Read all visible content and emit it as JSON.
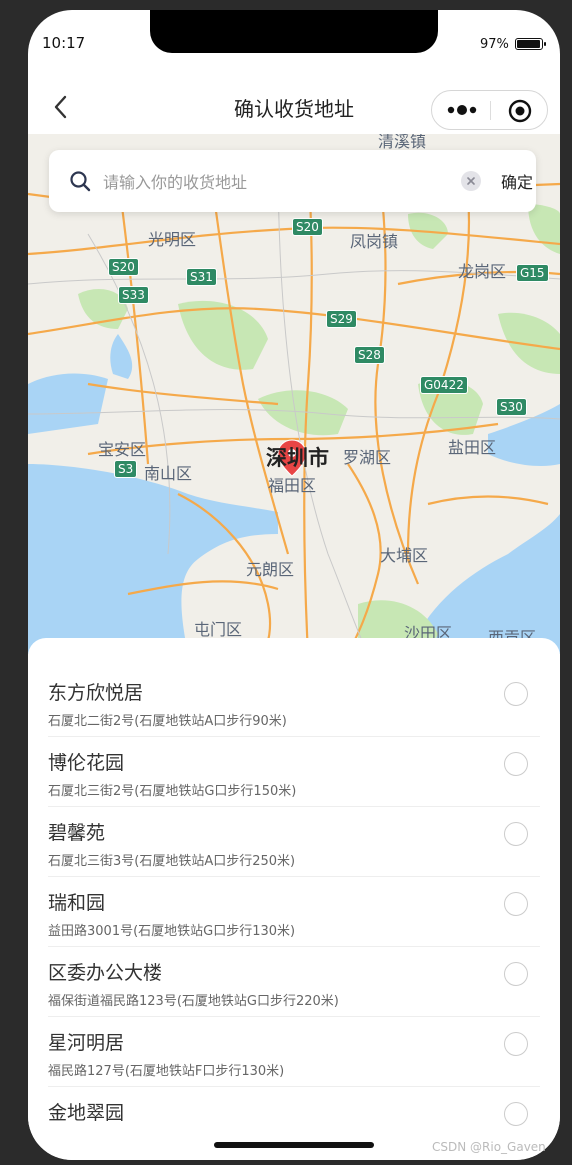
{
  "status_bar": {
    "time": "10:17",
    "battery": "97%",
    "battery_level": 0.97
  },
  "navbar": {
    "title": "确认收货地址",
    "icons": [
      "back-chevron-icon",
      "more-dots-icon",
      "close-target-icon"
    ]
  },
  "search": {
    "placeholder": "请输入你的收货地址",
    "value": "",
    "confirm_label": "确定"
  },
  "map": {
    "city": "深圳市",
    "districts": [
      "光明区",
      "凤岗镇",
      "龙岗区",
      "宝安区",
      "南山区",
      "罗湖区",
      "盐田区",
      "福田区",
      "元朗区",
      "大埔区",
      "屯门区",
      "沙田区",
      "西贡区",
      "清溪镇"
    ],
    "highways": [
      "S20",
      "S20",
      "S31",
      "S33",
      "S29",
      "S28",
      "G0422",
      "S30",
      "G15",
      "S3"
    ],
    "colors": {
      "land": "#f1efe9",
      "water": "#a9d4f5",
      "green": "#c7e7b4",
      "road": "#f5a94a",
      "marker": "#e84545"
    }
  },
  "addresses": [
    {
      "name": "东方欣悦居",
      "detail": "石厦北二街2号(石厦地铁站A口步行90米)"
    },
    {
      "name": "博伦花园",
      "detail": "石厦北三街2号(石厦地铁站G口步行150米)"
    },
    {
      "name": "碧馨苑",
      "detail": "石厦北三街3号(石厦地铁站A口步行250米)"
    },
    {
      "name": "瑞和园",
      "detail": "益田路3001号(石厦地铁站G口步行130米)"
    },
    {
      "name": "区委办公大楼",
      "detail": "福保街道福民路123号(石厦地铁站G口步行220米)"
    },
    {
      "name": "星河明居",
      "detail": "福民路127号(石厦地铁站F口步行130米)"
    },
    {
      "name": "金地翠园",
      "detail": ""
    }
  ],
  "watermark": "CSDN @Rio_Gaven"
}
